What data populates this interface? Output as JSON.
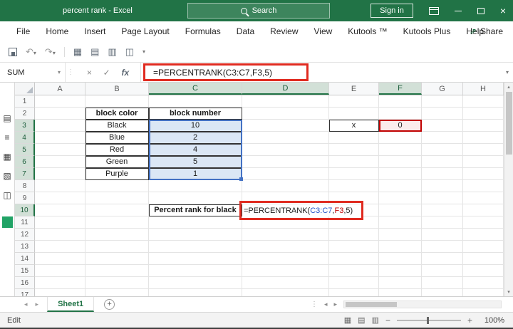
{
  "colors": {
    "excel-green": "#217346",
    "annotation-red": "#e02b20",
    "ref-blue": "#4472c4",
    "ref-red": "#c00000"
  },
  "title_bar": {
    "title": "percent rank  -  Excel",
    "search_placeholder": "Search",
    "sign_in_label": "Sign in"
  },
  "menu": {
    "items": [
      "File",
      "Home",
      "Insert",
      "Page Layout",
      "Formulas",
      "Data",
      "Review",
      "View",
      "Kutools ™",
      "Kutools Plus",
      "Help"
    ],
    "share_label": "Share"
  },
  "formula_bar": {
    "name_box_value": "SUM",
    "fx_label": "fx",
    "formula": "=PERCENTRANK(C3:C7,F3,5)"
  },
  "grid": {
    "columns": [
      "A",
      "B",
      "C",
      "D",
      "E",
      "F",
      "G",
      "H"
    ],
    "row_count": 17,
    "highlight_cols": [
      "C",
      "D",
      "F"
    ],
    "highlight_rows": [
      3,
      4,
      5,
      6,
      7,
      10
    ],
    "editing_cell": "D10",
    "formula_segments": [
      {
        "t": "=PERCENTRANK(",
        "c": "#1a1a1a"
      },
      {
        "t": "C3:C7",
        "c": "#2456c9"
      },
      {
        "t": ",",
        "c": "#1a1a1a"
      },
      {
        "t": "F3",
        "c": "#c00000"
      },
      {
        "t": ",5)",
        "c": "#1a1a1a"
      }
    ],
    "cells": {
      "B2": {
        "v": "block color",
        "cls": "tb bold"
      },
      "C2": {
        "v": "block number",
        "cls": "tb bold"
      },
      "B3": {
        "v": "Black",
        "cls": "tb"
      },
      "C3": {
        "v": "10",
        "cls": "tb ref1"
      },
      "B4": {
        "v": "Blue",
        "cls": "tb"
      },
      "C4": {
        "v": "2",
        "cls": "tb ref1"
      },
      "B5": {
        "v": "Red",
        "cls": "tb"
      },
      "C5": {
        "v": "4",
        "cls": "tb ref1"
      },
      "B6": {
        "v": "Green",
        "cls": "tb"
      },
      "C6": {
        "v": "5",
        "cls": "tb ref1"
      },
      "B7": {
        "v": "Purple",
        "cls": "tb"
      },
      "C7": {
        "v": "1",
        "cls": "tb ref1"
      },
      "E3": {
        "v": "x",
        "cls": "tb"
      },
      "F3": {
        "v": "0",
        "cls": "tb ref2"
      },
      "C10": {
        "v": "Percent rank for black",
        "cls": "tb bold"
      }
    }
  },
  "sheet_bar": {
    "tabs": [
      {
        "label": "Sheet1",
        "active": true
      }
    ]
  },
  "status_bar": {
    "mode": "Edit",
    "zoom": "100%"
  }
}
